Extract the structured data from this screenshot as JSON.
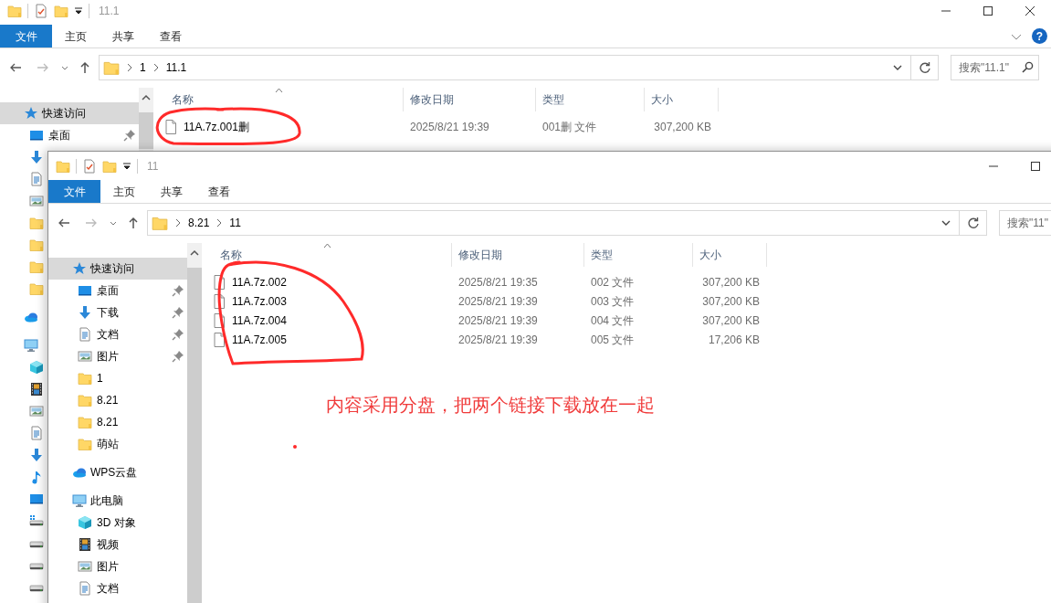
{
  "windows": [
    {
      "title": "11.1",
      "help": "?",
      "ribbon_tabs": [
        {
          "label": "文件",
          "selected": true
        },
        {
          "label": "主页",
          "selected": false
        },
        {
          "label": "共享",
          "selected": false
        },
        {
          "label": "查看",
          "selected": false
        }
      ],
      "path": [
        "1",
        "11.1"
      ],
      "search": {
        "placeholder": "搜索\"11.1\""
      },
      "nav": [
        {
          "kind": "star",
          "label": "快速访问",
          "selected": true,
          "children": [
            {
              "kind": "desktop",
              "label": "桌面",
              "pinned": true,
              "selected": false
            },
            {
              "kind": "download"
            },
            {
              "kind": "document"
            },
            {
              "kind": "picture"
            },
            {
              "kind": "folder"
            },
            {
              "kind": "folder"
            },
            {
              "kind": "folder"
            },
            {
              "kind": "folder"
            }
          ]
        },
        {
          "kind": "cloud"
        },
        {
          "kind": "computer",
          "children": [
            {
              "kind": "cube"
            },
            {
              "kind": "video"
            },
            {
              "kind": "picture"
            },
            {
              "kind": "document"
            },
            {
              "kind": "download"
            },
            {
              "kind": "music"
            },
            {
              "kind": "desktop"
            },
            {
              "kind": "system-drive"
            },
            {
              "kind": "drive"
            },
            {
              "kind": "drive"
            },
            {
              "kind": "drive"
            }
          ]
        }
      ],
      "columns": [
        {
          "label": "名称",
          "sorted": true
        },
        {
          "label": "修改日期",
          "sorted": false
        },
        {
          "label": "类型",
          "sorted": false
        },
        {
          "label": "大小",
          "sorted": false
        }
      ],
      "files": [
        {
          "name": "11A.7z.001删",
          "date": "2025/8/21 19:39",
          "type": "001删 文件",
          "size": "307,200 KB"
        }
      ]
    },
    {
      "title": "11",
      "ribbon_tabs": [
        {
          "label": "文件",
          "selected": true
        },
        {
          "label": "主页",
          "selected": false
        },
        {
          "label": "共享",
          "selected": false
        },
        {
          "label": "查看",
          "selected": false
        }
      ],
      "path": [
        "8.21",
        "11"
      ],
      "search": {
        "placeholder": "搜索\"11\""
      },
      "nav": [
        {
          "kind": "star",
          "label": "快速访问",
          "selected": true,
          "children": [
            {
              "kind": "desktop",
              "label": "桌面",
              "pinned": true,
              "selected": false
            },
            {
              "kind": "download",
              "label": "下载",
              "pinned": true,
              "selected": false
            },
            {
              "kind": "document",
              "label": "文档",
              "pinned": true,
              "selected": false
            },
            {
              "kind": "picture",
              "label": "图片",
              "pinned": true,
              "selected": false
            },
            {
              "kind": "folder",
              "label": "1",
              "selected": false
            },
            {
              "kind": "folder",
              "label": "8.21",
              "selected": false
            },
            {
              "kind": "folder",
              "label": "8.21",
              "selected": false
            },
            {
              "kind": "folder",
              "label": "萌站",
              "selected": false
            }
          ]
        },
        {
          "kind": "cloud",
          "label": "WPS云盘",
          "selected": false
        },
        {
          "kind": "computer",
          "label": "此电脑",
          "selected": false,
          "children": [
            {
              "kind": "cube",
              "label": "3D 对象",
              "selected": false
            },
            {
              "kind": "video",
              "label": "视频",
              "selected": false
            },
            {
              "kind": "picture",
              "label": "图片",
              "selected": false
            },
            {
              "kind": "document",
              "label": "文档",
              "selected": false
            }
          ]
        }
      ],
      "columns": [
        {
          "label": "名称",
          "sorted": true
        },
        {
          "label": "修改日期",
          "sorted": false
        },
        {
          "label": "类型",
          "sorted": false
        },
        {
          "label": "大小",
          "sorted": false
        }
      ],
      "files": [
        {
          "name": "11A.7z.002",
          "date": "2025/8/21 19:35",
          "type": "002 文件",
          "size": "307,200 KB"
        },
        {
          "name": "11A.7z.003",
          "date": "2025/8/21 19:39",
          "type": "003 文件",
          "size": "307,200 KB"
        },
        {
          "name": "11A.7z.004",
          "date": "2025/8/21 19:39",
          "type": "004 文件",
          "size": "307,200 KB"
        },
        {
          "name": "11A.7z.005",
          "date": "2025/8/21 19:39",
          "type": "005 文件",
          "size": "17,206 KB"
        }
      ]
    }
  ],
  "annotations": [
    {
      "kind": "text",
      "text": "内容采用分盘，把两个链接下载放在一起"
    }
  ]
}
